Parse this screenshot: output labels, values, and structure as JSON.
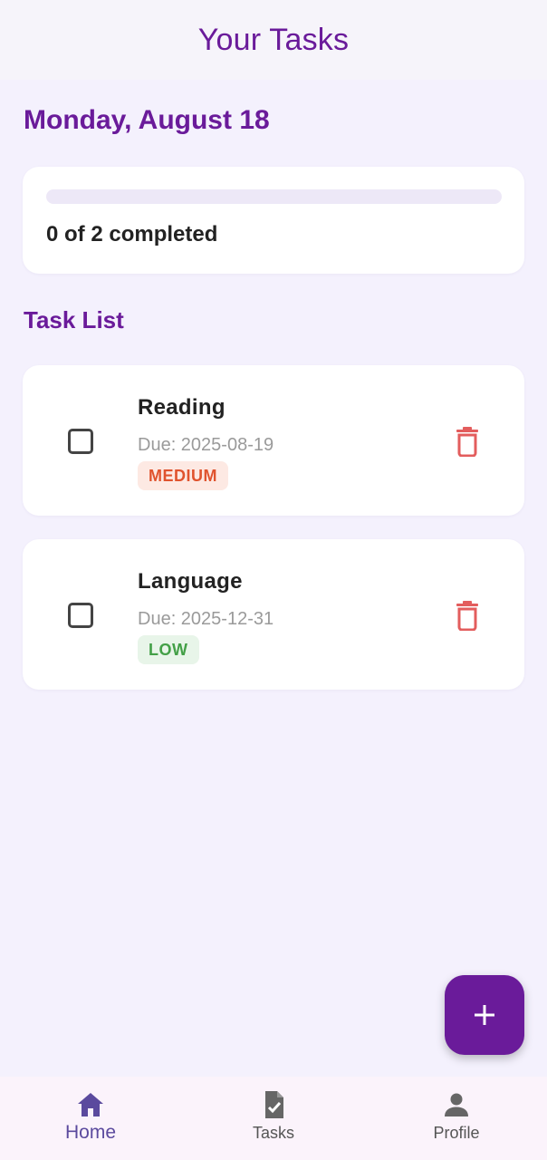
{
  "appbar": {
    "title": "Your Tasks"
  },
  "date_heading": "Monday, August 18",
  "progress": {
    "completed": 0,
    "total": 2,
    "fraction": 0.0,
    "label": "0 of 2 completed"
  },
  "task_list": {
    "heading": "Task List",
    "tasks": [
      {
        "title": "Reading",
        "due": "Due: 2025-08-19",
        "priority": "MEDIUM",
        "completed": false
      },
      {
        "title": "Language",
        "due": "Due: 2025-12-31",
        "priority": "LOW",
        "completed": false
      }
    ]
  },
  "fab": {
    "icon": "plus-icon"
  },
  "bottom_nav": {
    "items": [
      {
        "label": "Home",
        "icon": "home-icon",
        "active": true
      },
      {
        "label": "Tasks",
        "icon": "task-document-icon",
        "active": false
      },
      {
        "label": "Profile",
        "icon": "person-icon",
        "active": false
      }
    ]
  },
  "colors": {
    "primary": "#6a1b9a",
    "background": "#f4f1fd",
    "delete": "#e35d5d",
    "medium_badge_bg": "#fde9e3",
    "medium_badge_text": "#e0532e",
    "low_badge_bg": "#e8f5e9",
    "low_badge_text": "#43a047",
    "nav_active": "#5b4a9e"
  }
}
